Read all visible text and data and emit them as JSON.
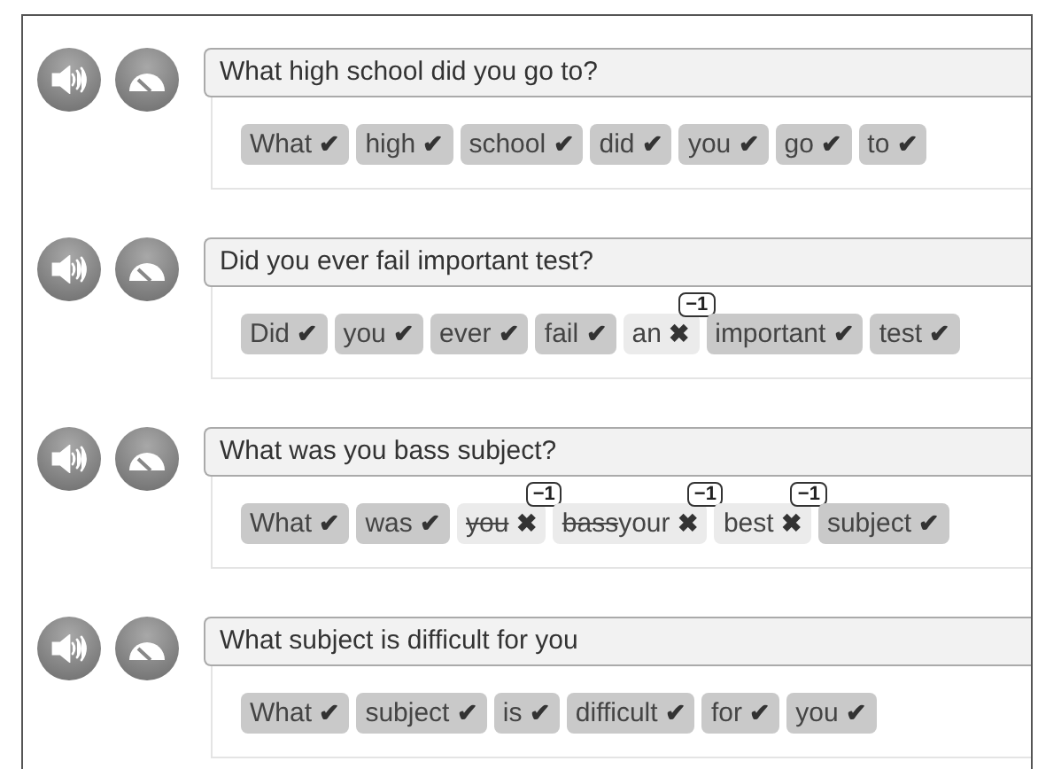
{
  "exercises": [
    {
      "question": "What high school did you go to?",
      "tokens": [
        {
          "text": "What",
          "kind": "correct",
          "mark": "✔"
        },
        {
          "text": "high",
          "kind": "correct",
          "mark": "✔"
        },
        {
          "text": "school",
          "kind": "correct",
          "mark": "✔"
        },
        {
          "text": "did",
          "kind": "correct",
          "mark": "✔"
        },
        {
          "text": "you",
          "kind": "correct",
          "mark": "✔"
        },
        {
          "text": "go",
          "kind": "correct",
          "mark": "✔"
        },
        {
          "text": "to",
          "kind": "correct",
          "mark": "✔"
        }
      ]
    },
    {
      "question": "Did you ever fail important test?",
      "tokens": [
        {
          "text": "Did",
          "kind": "correct",
          "mark": "✔"
        },
        {
          "text": "you",
          "kind": "correct",
          "mark": "✔"
        },
        {
          "text": "ever",
          "kind": "correct",
          "mark": "✔"
        },
        {
          "text": "fail",
          "kind": "correct",
          "mark": "✔"
        },
        {
          "text": "an",
          "kind": "wrong",
          "mark": "✖",
          "penalty": "−1"
        },
        {
          "text": "important",
          "kind": "correct",
          "mark": "✔"
        },
        {
          "text": "test",
          "kind": "correct",
          "mark": "✔"
        }
      ]
    },
    {
      "question": "What was you bass subject?",
      "tokens": [
        {
          "text": "What",
          "kind": "correct",
          "mark": "✔"
        },
        {
          "text": "was",
          "kind": "correct",
          "mark": "✔"
        },
        {
          "struck": "you",
          "kind": "wrong",
          "mark": "✖",
          "penalty": "−1"
        },
        {
          "struck": "bass",
          "text": "your",
          "kind": "wrong",
          "mark": "✖",
          "penalty": "−1"
        },
        {
          "text": "best",
          "kind": "wrong",
          "mark": "✖",
          "penalty": "−1"
        },
        {
          "text": "subject",
          "kind": "correct",
          "mark": "✔"
        }
      ]
    },
    {
      "question": "What subject is difficult for you",
      "tokens": [
        {
          "text": "What",
          "kind": "correct",
          "mark": "✔"
        },
        {
          "text": "subject",
          "kind": "correct",
          "mark": "✔"
        },
        {
          "text": "is",
          "kind": "correct",
          "mark": "✔"
        },
        {
          "text": "difficult",
          "kind": "correct",
          "mark": "✔"
        },
        {
          "text": "for",
          "kind": "correct",
          "mark": "✔"
        },
        {
          "text": "you",
          "kind": "correct",
          "mark": "✔"
        }
      ]
    }
  ]
}
